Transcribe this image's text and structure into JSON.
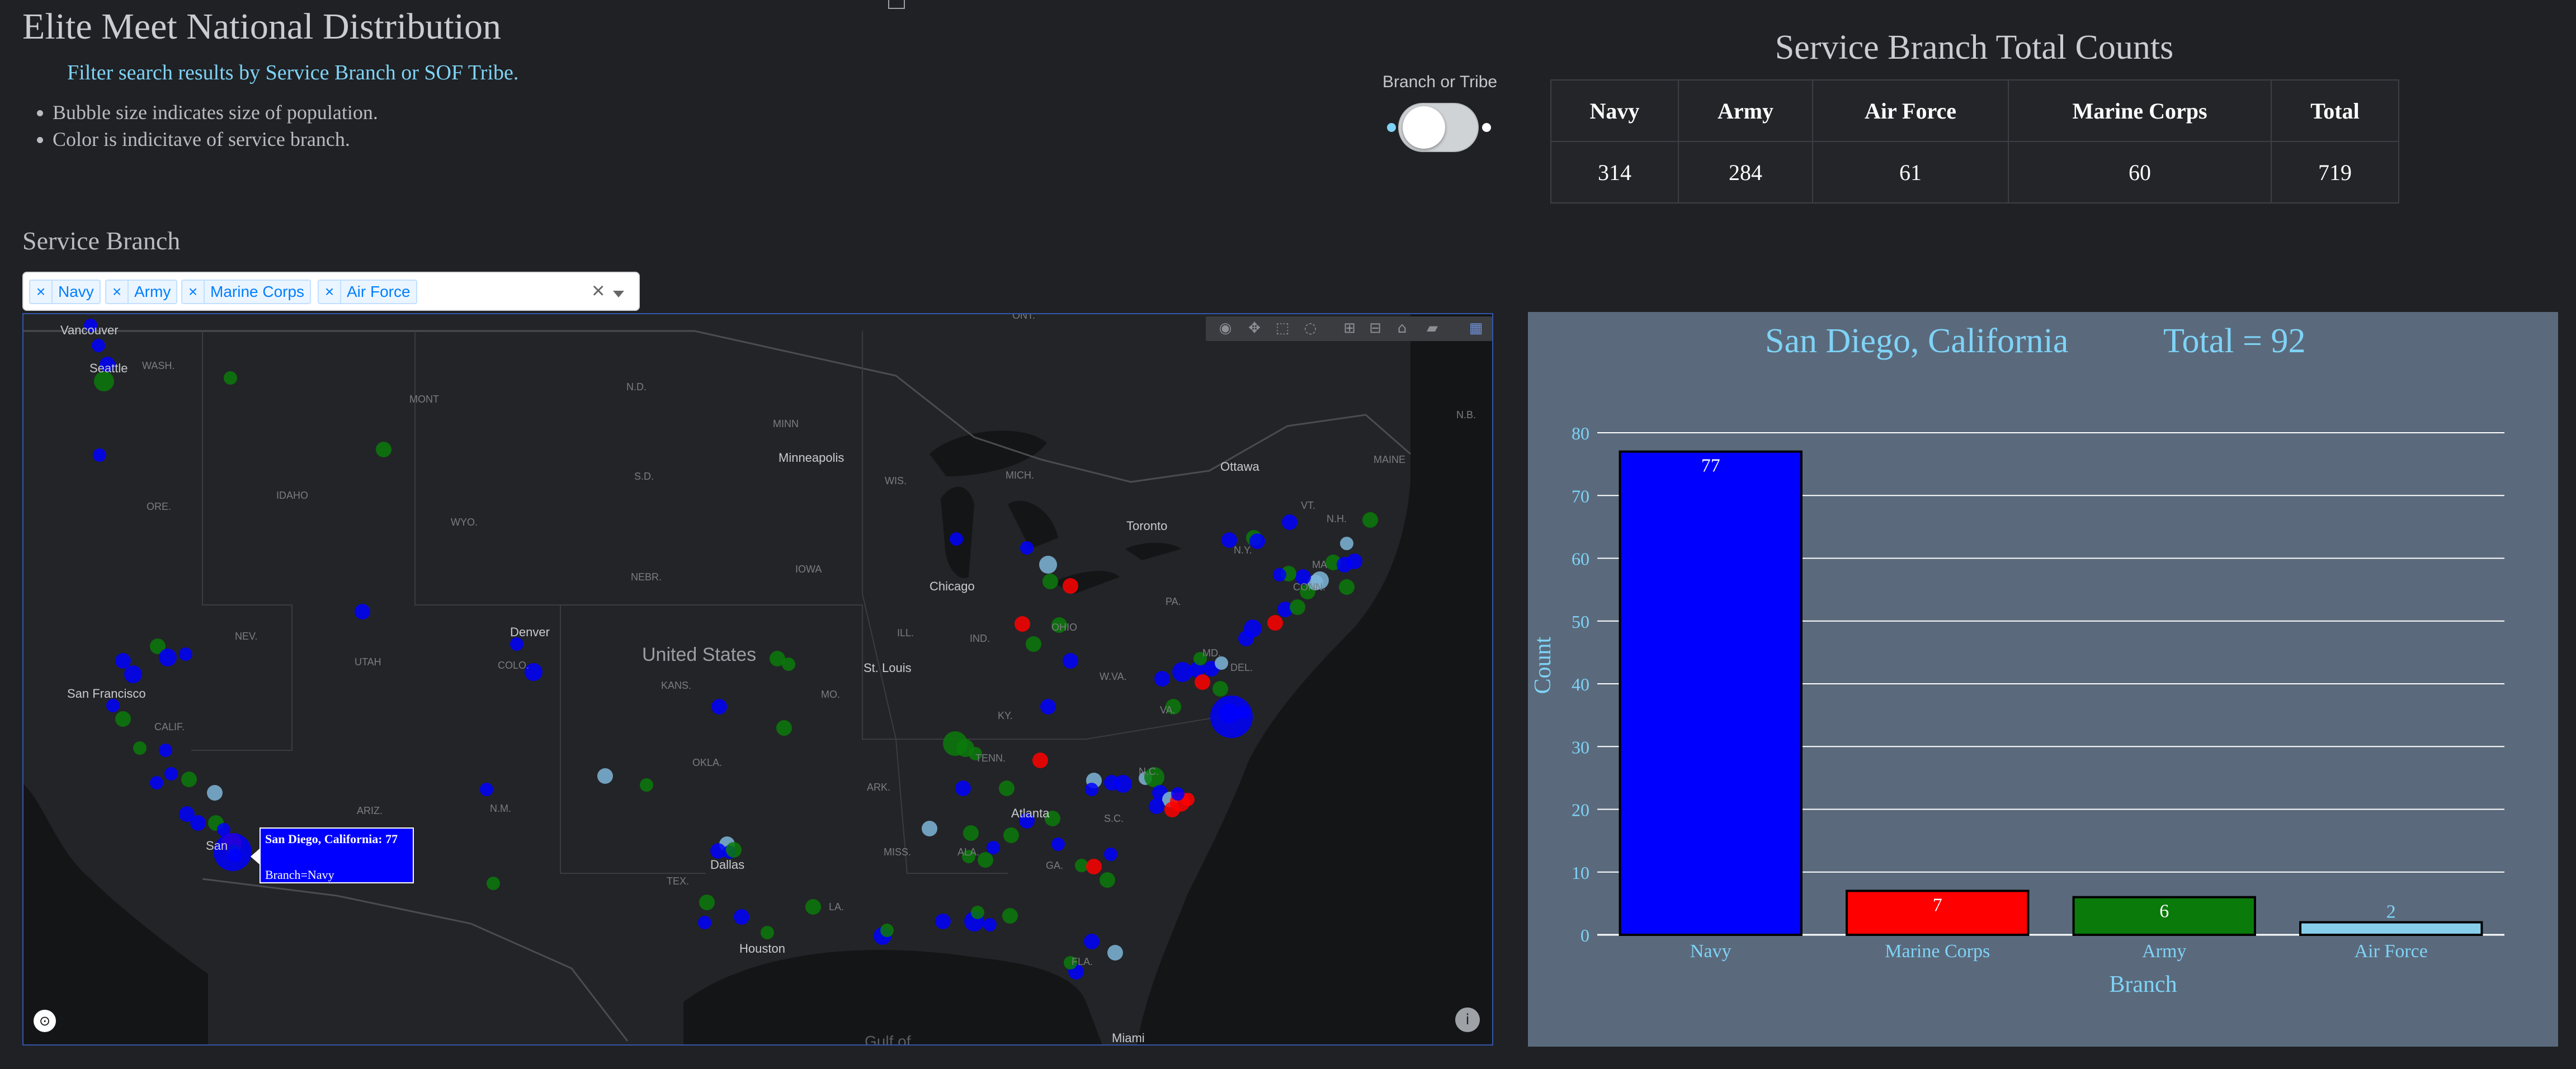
{
  "page": {
    "title": "Elite Meet National Distribution",
    "filter_note": "Filter search results by Service Branch or SOF Tribe.",
    "bullets": [
      "Bubble size indicates size of population.",
      "Color is indicitave of service branch."
    ]
  },
  "toggle": {
    "label": "Branch or Tribe",
    "state": "off"
  },
  "totals": {
    "title": "Service Branch Total Counts",
    "headers": [
      "Navy",
      "Army",
      "Air Force",
      "Marine Corps",
      "Total"
    ],
    "values": [
      "314",
      "284",
      "61",
      "60",
      "719"
    ]
  },
  "service_branch": {
    "label": "Service Branch",
    "selected": [
      "Navy",
      "Army",
      "Marine Corps",
      "Air Force"
    ],
    "clear_symbol": "×",
    "remove_symbol": "×"
  },
  "map": {
    "labels": {
      "vancouver": "Vancouver",
      "seattle": "Seattle",
      "wash": "WASH.",
      "mont": "MONT",
      "nd": "N.D.",
      "minn": "MINN",
      "minneapolis": "Minneapolis",
      "wis": "WIS.",
      "mich": "MICH.",
      "ottawa": "Ottawa",
      "maine": "MAINE",
      "nb": "N.B.",
      "toronto": "Toronto",
      "vt": "VT.",
      "nh": "N.H.",
      "ma": "MA",
      "conn": "CONN.",
      "ny": "N.Y.",
      "pa": "PA.",
      "idaho": "IDAHO",
      "ore": "ORE.",
      "sd": "S.D.",
      "wyo": "WYO.",
      "nebr": "NEBR.",
      "iowa": "IOWA",
      "chicago": "Chicago",
      "ill": "ILL.",
      "ind": "IND.",
      "ohio": "OHIO",
      "nev": "NEV.",
      "utah": "UTAH",
      "denver": "Denver",
      "colo": "COLO.",
      "united_states": "United States",
      "kans": "KANS.",
      "stlouis": "St. Louis",
      "mo": "MO.",
      "wva": "W.VA.",
      "va": "VA.",
      "md": "MD.",
      "del": "DEL.",
      "sanfrancisco": "San Francisco",
      "calif": "CALIF.",
      "ky": "KY.",
      "tenn": "TENN.",
      "nc": "N.C.",
      "okla": "OKLA.",
      "ark": "ARK.",
      "sc": "S.C.",
      "atlanta": "Atlanta",
      "ariz": "ARIZ.",
      "nm": "N.M.",
      "miss": "MISS.",
      "ala": "ALA.",
      "ga": "GA.",
      "san": "San",
      "dallas": "Dallas",
      "tex": "TEX.",
      "la": "LA.",
      "houston": "Houston",
      "fla": "FLA.",
      "gulf": "Gulf of",
      "miami": "Miami",
      "ont": "ONT."
    },
    "tooltip": {
      "line1": "San Diego, California: 77",
      "line2": "Branch=Navy"
    },
    "branch_colors": {
      "Navy": "#0000ff",
      "Army": "#0a7a0a",
      "Air Force": "#7eb6d9",
      "Marine Corps": "#ff0000"
    },
    "logo_icon": "mapbox-logo-icon",
    "info_icon": "info-icon"
  },
  "chart_data": {
    "type": "bar",
    "title": "San Diego, California",
    "total_label": "Total = 92",
    "categories": [
      "Navy",
      "Marine Corps",
      "Army",
      "Air Force"
    ],
    "values": [
      77,
      7,
      6,
      2
    ],
    "colors": [
      "#0000ff",
      "#ff0000",
      "#0a7a0a",
      "#87ceeb"
    ],
    "xlabel": "Branch",
    "ylabel": "Count",
    "ylim": [
      0,
      80
    ],
    "yticks": [
      0,
      10,
      20,
      30,
      40,
      50,
      60,
      70,
      80
    ],
    "grid": true,
    "data_labels": true
  }
}
